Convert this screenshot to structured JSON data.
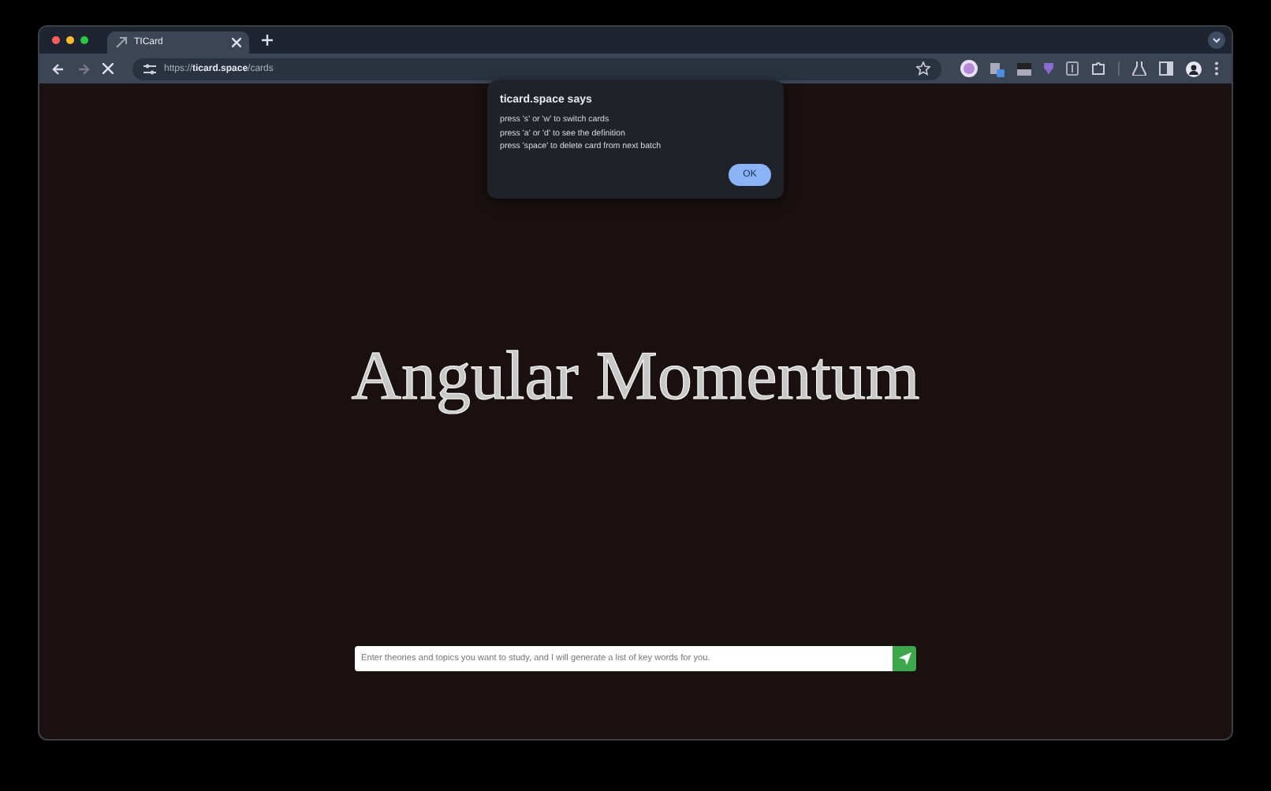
{
  "browser": {
    "tab": {
      "title": "TICard"
    },
    "url": "https://**ticard.space**/cards"
  },
  "dialog": {
    "title": "ticard.space says",
    "lines": [
      "press 's' or 'w' to switch cards",
      "press 'a' or 'd' to see the definition",
      "press 'space' to delete card from next batch"
    ],
    "button": "OK"
  },
  "card": {
    "term": "Angular Momentum"
  },
  "prompt": {
    "placeholder": "Enter theories and topics you want to study, and I will generate a list of key words for you."
  }
}
